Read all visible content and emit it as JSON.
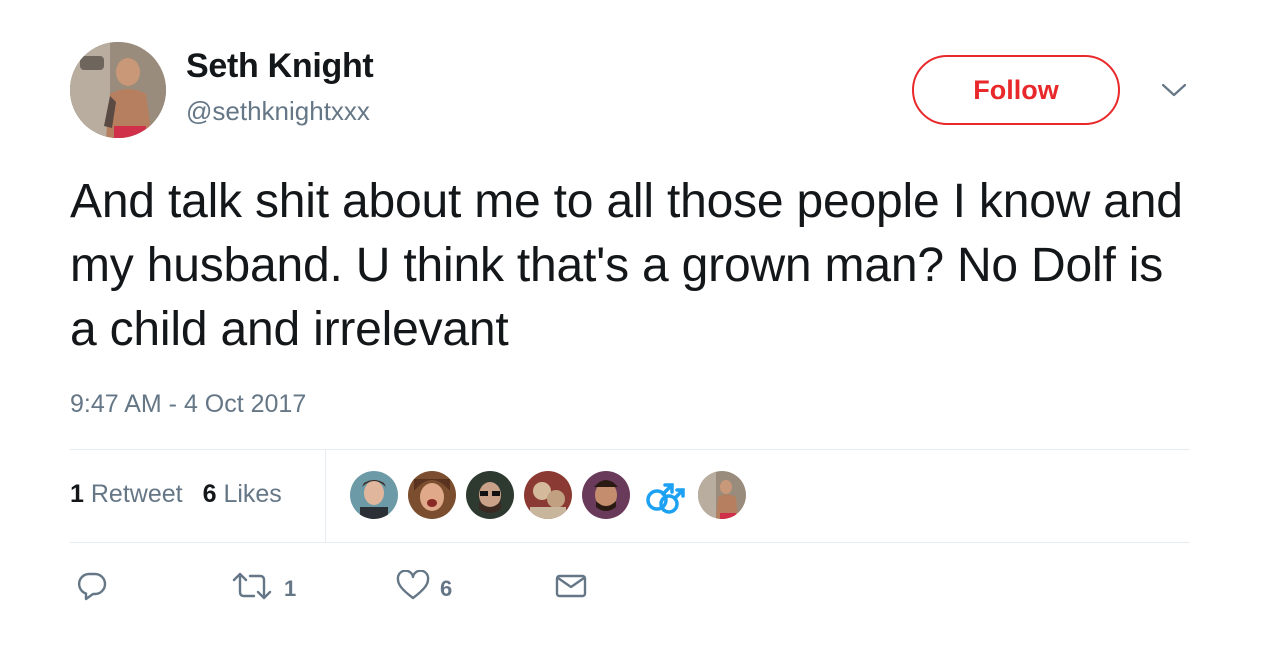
{
  "user": {
    "name": "Seth Knight",
    "handle": "@sethknightxxx"
  },
  "follow_label": "Follow",
  "tweet": {
    "text": "And talk shit about me to all those people I know and my husband. U think that's a grown man? No Dolf is a child and irrelevant",
    "timestamp": "9:47 AM - 4 Oct 2017"
  },
  "stats": {
    "retweets_count": "1",
    "retweets_label": "Retweet",
    "likes_count": "6",
    "likes_label": "Likes"
  },
  "liker_avatars": [
    "avatar",
    "avatar",
    "avatar",
    "avatar",
    "avatar",
    "male-symbols-icon",
    "avatar"
  ],
  "actions": {
    "reply_icon": "reply-icon",
    "retweet_icon": "retweet-icon",
    "retweet_count": "1",
    "like_icon": "heart-icon",
    "like_count": "6",
    "dm_icon": "envelope-icon"
  },
  "colors": {
    "follow_red": "#e8282a",
    "secondary_text": "#657786",
    "primary_text": "#14171a",
    "divider": "#e6ecf0"
  }
}
